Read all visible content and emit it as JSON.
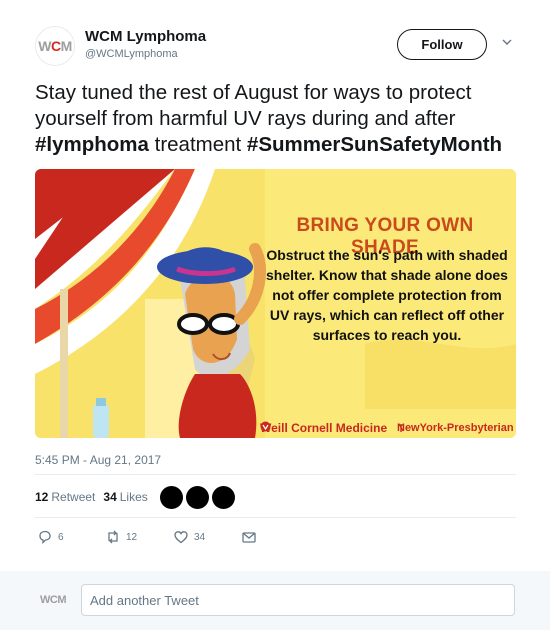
{
  "author": {
    "display_name": "WCM Lymphoma",
    "handle": "@WCMLymphoma",
    "avatar_w": "W",
    "avatar_c": "C",
    "avatar_m": "M"
  },
  "follow_label": "Follow",
  "tweet": {
    "line1": "Stay tuned the rest of August for ways to protect yourself from harmful UV rays during and after ",
    "hashtag1": "#lymphoma",
    "middle": " treatment ",
    "hashtag2": "#SummerSunSafetyMonth"
  },
  "media": {
    "title": "BRING YOUR OWN SHADE",
    "body": "Obstruct the sun's path with shaded shelter. Know that shade alone does not offer complete protection from UV rays, which can reflect off other surfaces to reach you.",
    "logo_left": "Weill Cornell Medicine",
    "logo_right": "NewYork-Presbyterian"
  },
  "timestamp": "5:45 PM - Aug 21, 2017",
  "stats": {
    "retweet_count": "12",
    "retweet_label": "Retweet",
    "like_count": "34",
    "like_label": "Likes"
  },
  "actions": {
    "reply_count": "6",
    "retweet_count": "12",
    "like_count": "34"
  },
  "reply": {
    "avatar_text": "WCM",
    "placeholder": "Add another Tweet"
  },
  "colors": {
    "brand_red": "#d52b1e",
    "muted": "#657786",
    "panel_yellow": "#fbe97a"
  }
}
